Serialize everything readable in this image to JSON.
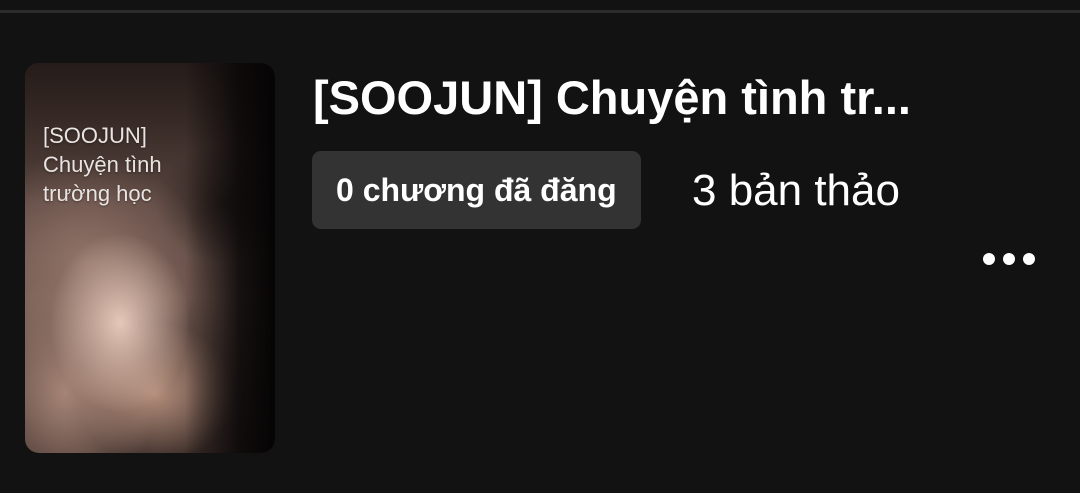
{
  "story": {
    "title": "[SOOJUN] Chuyện tình tr...",
    "cover": {
      "text_line1": "[SOOJUN]",
      "text_line2": "Chuyện tình",
      "text_line3": "trường học"
    },
    "published_label": "0 chương đã đăng",
    "drafts_label": "3 bản thảo",
    "more_icon": "more-horizontal-icon"
  },
  "colors": {
    "background": "#121212",
    "badge_background": "#333333",
    "text": "#ffffff"
  }
}
